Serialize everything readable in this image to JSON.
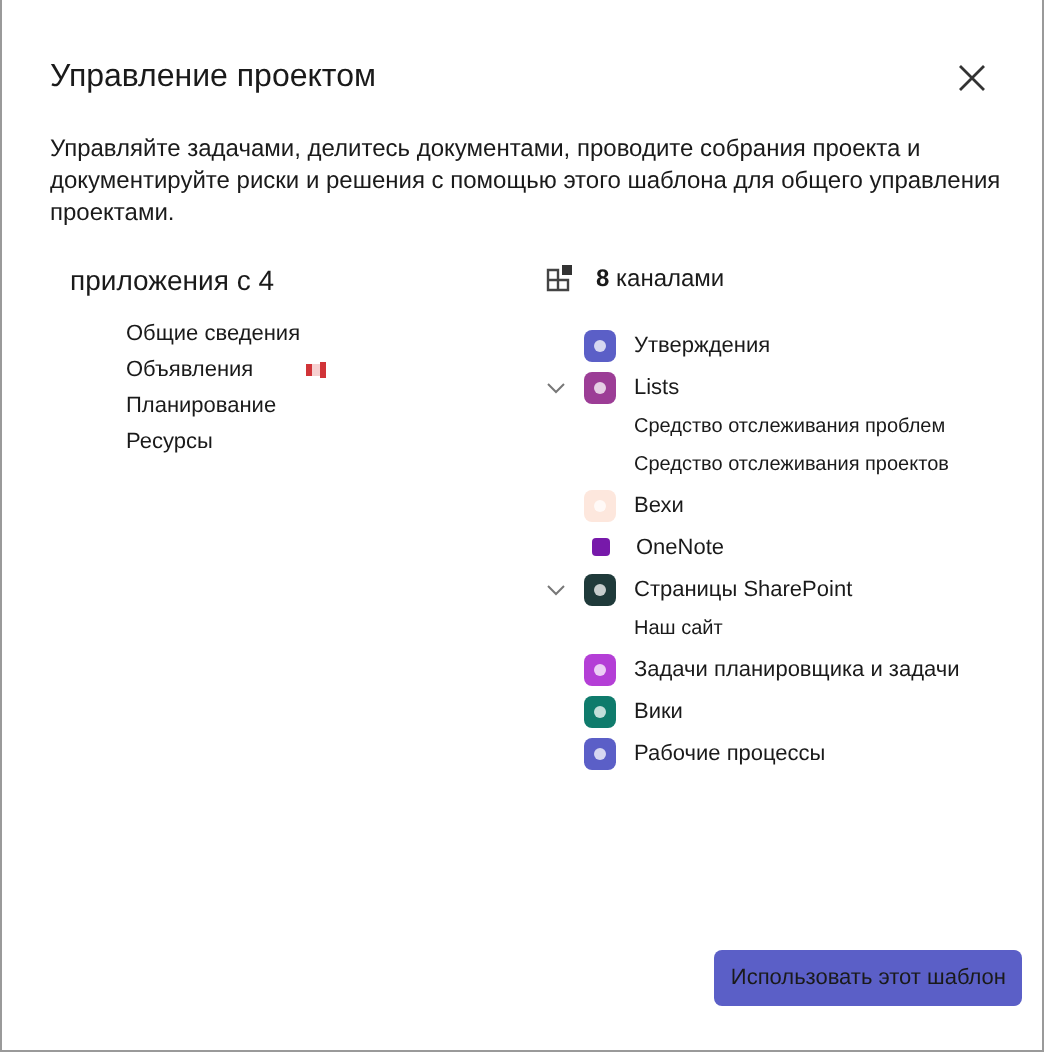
{
  "dialog": {
    "title": "Управление проектом",
    "description": "Управляйте задачами, делитесь документами, проводите собрания проекта и документируйте риски и решения с помощью этого шаблона для общего управления проектами."
  },
  "apps": {
    "heading": "приложения с 4",
    "items": [
      "Общие сведения",
      "Объявления",
      "Планирование",
      "Ресурсы"
    ]
  },
  "channels": {
    "heading": "**8** каналами",
    "items": [
      {
        "kind": "item",
        "label": "Утверждения",
        "color": "#5b5fc7"
      },
      {
        "kind": "group",
        "label": "Lists",
        "color": "#9c3d96",
        "expanded": true,
        "children": [
          "Средство отслеживания проблем",
          "Средство отслеживания проектов"
        ]
      },
      {
        "kind": "item",
        "label": "Вехи",
        "color": "#fde7dd"
      },
      {
        "kind": "small",
        "label": "OneNote",
        "color": "#7719aa"
      },
      {
        "kind": "group",
        "label": "Страницы SharePoint",
        "color": "#1f3a3a",
        "expanded": true,
        "children": [
          "Наш сайт"
        ]
      },
      {
        "kind": "item",
        "label": "Задачи планировщика и задачи",
        "color": "#b43fd6"
      },
      {
        "kind": "item",
        "label": "Вики",
        "color": "#0f7b6c"
      },
      {
        "kind": "item",
        "label": "Рабочие процессы",
        "color": "#5b5fc7"
      }
    ]
  },
  "buttons": [
    "Использовать этот шаблон"
  ]
}
